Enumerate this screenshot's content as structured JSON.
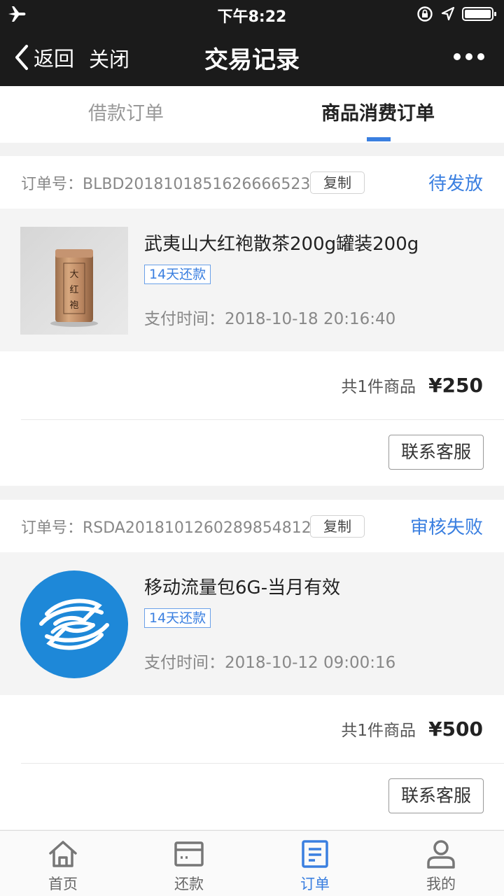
{
  "status_bar": {
    "time": "下午8:22"
  },
  "nav": {
    "back_label": "返回",
    "close_label": "关闭",
    "title": "交易记录"
  },
  "tabs": [
    {
      "label": "借款订单",
      "active": false
    },
    {
      "label": "商品消费订单",
      "active": true
    }
  ],
  "orders": [
    {
      "order_no": "订单号：BLBD2018101851626666523",
      "copy_label": "复制",
      "status": "待发放",
      "product_name": "武夷山大红袍散茶200g罐装200g",
      "tag": "14天还款",
      "pay_time": "支付时间：2018-10-18 20:16:40",
      "count_label": "共1件商品",
      "price": "¥250",
      "service_label": "联系客服",
      "image_text": [
        "大",
        "红",
        "袍"
      ]
    },
    {
      "order_no": "订单号：RSDA2018101260289854812",
      "copy_label": "复制",
      "status": "审核失败",
      "product_name": "移动流量包6G-当月有效",
      "tag": "14天还款",
      "pay_time": "支付时间：2018-10-12 09:00:16",
      "count_label": "共1件商品",
      "price": "¥500",
      "service_label": "联系客服"
    }
  ],
  "bottom_nav": [
    {
      "label": "首页",
      "icon": "home-icon",
      "active": false
    },
    {
      "label": "还款",
      "icon": "card-icon",
      "active": false
    },
    {
      "label": "订单",
      "icon": "order-icon",
      "active": true
    },
    {
      "label": "我的",
      "icon": "person-icon",
      "active": false
    }
  ],
  "colors": {
    "accent": "#3a7fe0",
    "bar": "#1b1b1b",
    "mobile_blue": "#1e88d8"
  }
}
